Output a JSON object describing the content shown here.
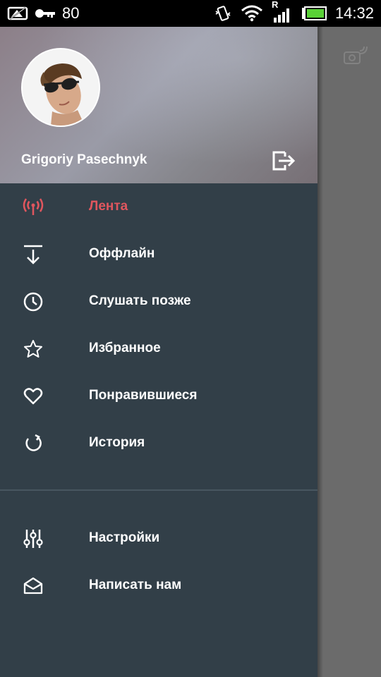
{
  "status_bar": {
    "battery_level_text": "80",
    "time": "14:32",
    "roaming_indicator": "R",
    "icons": [
      "screenshot-icon",
      "key-icon",
      "vibrate-icon",
      "wifi-icon",
      "signal-icon",
      "battery-icon"
    ]
  },
  "drawer": {
    "user_name": "Grigoriy Pasechnyk",
    "menu_items": [
      {
        "label": "Лента",
        "icon": "podcast-broadcast-icon",
        "active": true
      },
      {
        "label": "Оффлайн",
        "icon": "download-icon",
        "active": false
      },
      {
        "label": "Слушать позже",
        "icon": "clock-icon",
        "active": false
      },
      {
        "label": "Избранное",
        "icon": "star-icon",
        "active": false
      },
      {
        "label": "Понравившиеся",
        "icon": "heart-icon",
        "active": false
      },
      {
        "label": "История",
        "icon": "history-icon",
        "active": false
      }
    ],
    "secondary_items": [
      {
        "label": "Настройки",
        "icon": "sliders-icon"
      },
      {
        "label": "Написать нам",
        "icon": "mail-icon"
      }
    ]
  },
  "colors": {
    "drawer_bg": "#323f48",
    "active_accent": "#e0565e",
    "text": "#ffffff",
    "status_bar_bg": "#000000"
  }
}
